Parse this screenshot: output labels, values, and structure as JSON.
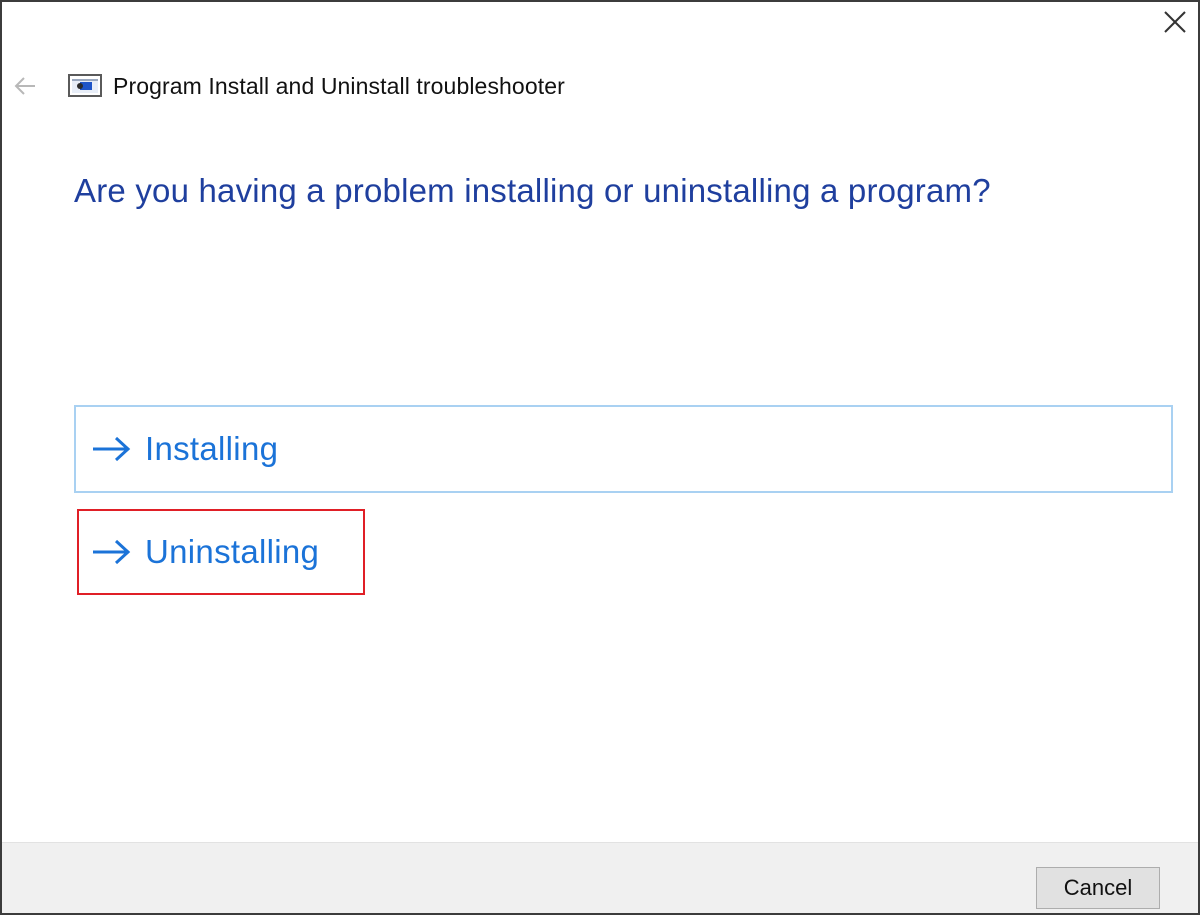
{
  "window": {
    "title": "Program Install and Uninstall troubleshooter",
    "icons": {
      "back": "back-arrow-icon",
      "close": "close-icon",
      "app": "troubleshooter-app-icon"
    }
  },
  "main": {
    "heading": "Are you having a problem installing or uninstalling a program?",
    "options": [
      {
        "label": "Installing",
        "icon": "right-arrow-icon",
        "highlighted": false
      },
      {
        "label": "Uninstalling",
        "icon": "right-arrow-icon",
        "highlighted": true
      }
    ]
  },
  "footer": {
    "cancel_label": "Cancel"
  },
  "colors": {
    "heading": "#1f3f9e",
    "option_text": "#1b73d8",
    "option_border": "#a9d1f2",
    "highlight_box": "#e01f26",
    "footer_bg": "#f0f0f0"
  }
}
